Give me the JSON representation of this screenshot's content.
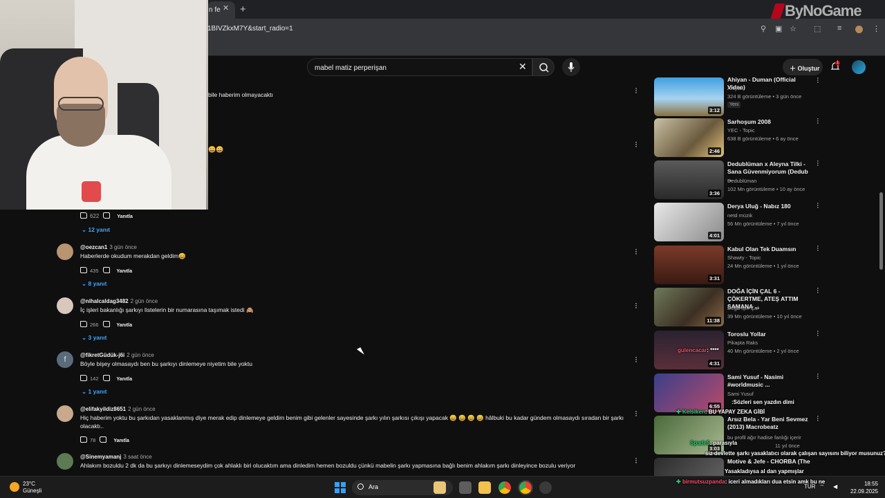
{
  "browser": {
    "tab_label": "n fe",
    "url_fragment": "1BIVZkxM7Y&start_radio=1"
  },
  "watermark": "ByNoGame",
  "youtube": {
    "search_query": "mabel matiz perperişan",
    "create_label": "Oluştur",
    "notification_count": "1"
  },
  "comments": {
    "partial_top_text": "bile haberim olmayacaktı",
    "partial_emoji": "😄😄",
    "first_likes": "622",
    "first_replies": "12 yanıt",
    "reply_label": "Yanıtla",
    "items": [
      {
        "author": "@oezcan1",
        "time": "3 gün önce",
        "text": "Haberlerde okudum merakdan geldim😄",
        "likes": "435",
        "replies": "8 yanıt"
      },
      {
        "author": "@nihalcaldag3482",
        "time": "2 gün önce",
        "text": "İç işleri bakanlığı şarkıyı listelerin bir numarasına taşımak istedi 🙈",
        "likes": "266",
        "replies": "3 yanıt"
      },
      {
        "author": "@fikretGüdük-j6i",
        "time": "2 gün önce",
        "text": "Böyle bişey olmasaydı ben bu şarkıyı dinlemeye niyetim bile yoktu",
        "likes": "142",
        "replies": "1 yanıt",
        "avatar_letter": "f"
      },
      {
        "author": "@elifakyildiz8651",
        "time": "2 gün önce",
        "text": "Hiç haberim yoktu bu şarkıdan yasaklanmış diye merak edip dinlemeye geldim benim gibi gelenler sayesinde şarkı yılın şarkısı çıkışı yapacak 😄 😄 😄 😄 hâlbuki bu kadar gündem olmasaydı sıradan bir şarkı olacaktı..",
        "likes": "78"
      },
      {
        "author": "@Sinemyamanj",
        "time": "3 saat önce",
        "text": "Ahlakım bozuldu 2 dk da bu şarkıyı dinlemeseydim çok ahlaklı biri olucaktım ama dinledim hemen bozuldu çünkü mabelin şarkı yapmasına bağlı benim ahlakım şarkı dinleyince bozulu veriyor"
      }
    ]
  },
  "sidebar": {
    "videos": [
      {
        "title": "Ahiyan - Duman (Official Video)",
        "channel": "Ahiyan",
        "meta": "324 B görüntüleme • 3 gün önce",
        "duration": "3:12",
        "badge": "Yeni"
      },
      {
        "title": "Sarhoşum 2008",
        "channel": "YEC - Topic",
        "meta": "638 B görüntüleme • 6 ay önce",
        "duration": "2:46"
      },
      {
        "title": "Dedublüman x Aleyna Tilki - Sana Güvenmiyorum (Dedub ...",
        "channel": "Dedublüman",
        "meta": "102 Mn görüntüleme • 10 ay önce",
        "duration": "3:36"
      },
      {
        "title": "Derya Uluğ - Nabız 180",
        "channel": "netd müzik",
        "meta": "56 Mn görüntüleme • 7 yıl önce",
        "duration": "4:01"
      },
      {
        "title": "Kabul Olan Tek Duamsın",
        "channel": "Shawty - Topic",
        "meta": "24 Mn görüntüleme • 1 yıl önce",
        "duration": "3:31"
      },
      {
        "title": "DOĞA İÇİN ÇAL 6 - ÇÖKERTME, ATEŞ ATTIM SAMANA ...",
        "channel": "Doğa İçin Çal",
        "meta": "39 Mn görüntüleme • 10 yıl önce",
        "duration": "11:38"
      },
      {
        "title": "Toroslu Yollar",
        "channel": "Pikapta Raks",
        "meta": "40 Mn görüntüleme • 2 yıl önce",
        "duration": "4:31"
      },
      {
        "title": "Sami Yusuf - Nasimi #worldmusic ...",
        "channel": "Sami Yusuf",
        "meta": "",
        "duration": "6:55"
      },
      {
        "title": "Arsız Bela - Yar Beni Sevmez (2013) Macrobeatz",
        "channel": "bu profil ağır hadise fanlığı içerir",
        "meta": "11 yıl önce",
        "duration": "3:03"
      },
      {
        "title": "Motive & Jefe - CHORBA (The",
        "channel": "",
        "meta": "",
        "duration": ""
      }
    ]
  },
  "chat": [
    {
      "user": "gulencacar",
      "msg": ": ****"
    },
    {
      "user": "",
      "msg": ":Sözleri sen yazdın dimi"
    },
    {
      "user": "Kelsiken",
      "msg": ": BU YAPAY ZEKA GİBİ"
    },
    {
      "user": "Spade5",
      "msg": ": parasıyla"
    },
    {
      "user": "",
      "msg": "siz devlette şarkı yasaklatıcı olarak çalışan sayısını biliyor musunuz?"
    },
    {
      "user": "",
      "msg": "Yasakladıysa al dan yapmışlar"
    },
    {
      "user": "birmutsuzpanda",
      "msg": ": iceri almadıkları dua etsin amk bu ne"
    }
  ],
  "taskbar": {
    "temperature": "23°C",
    "weather": "Güneşli",
    "search_label": "Ara",
    "language": "TUR",
    "time": "18:55",
    "date": "22.09.2025"
  }
}
